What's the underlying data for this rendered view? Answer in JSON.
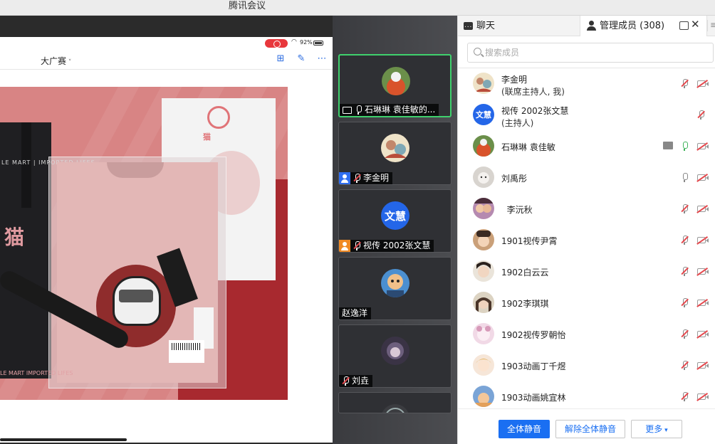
{
  "window": {
    "title": "腾讯会议"
  },
  "shared_screen": {
    "status_battery": "92%",
    "doc_title": "大广赛",
    "artwork_texts": {
      "bag_text": "LE MART",
      "bag_text_tail": "IMPORTED LIFES",
      "bag_bottom_text": "LE MART   IMPORTED LIFES",
      "card_brand": "猫"
    }
  },
  "video_tiles": [
    {
      "label": "石琳琳 袁佳敏的...",
      "active": true,
      "avatar_type": "image"
    },
    {
      "label": "李金明",
      "active": false,
      "avatar_type": "image"
    },
    {
      "label": "视传 2002张文慧",
      "active": false,
      "avatar_type": "text",
      "avatar_text": "文慧"
    },
    {
      "label": "赵逸洋",
      "active": false,
      "avatar_type": "image"
    },
    {
      "label": "刘垚",
      "active": false,
      "avatar_type": "image"
    }
  ],
  "panel": {
    "tab_chat": "聊天",
    "tab_members": "管理成员 (308)",
    "search_placeholder": "搜索成员",
    "members": [
      {
        "name": "李金明",
        "role": "(联席主持人, 我)",
        "mic": "off",
        "avatar": "sketch"
      },
      {
        "name": "视传 2002张文慧",
        "role": "(主持人)",
        "mic": "off",
        "avatar_text": "文慧"
      },
      {
        "name": "石琳琳 袁佳敏",
        "role": "",
        "mic": "on",
        "sharing": true,
        "avatar": "photo1"
      },
      {
        "name": "刘禹彤",
        "role": "",
        "mic": "idle",
        "avatar": "photo2"
      },
      {
        "name": "  李沅秋",
        "role": "",
        "mic": "off",
        "avatar": "photo3"
      },
      {
        "name": "1901视传尹霄",
        "role": "",
        "mic": "off",
        "avatar": "photo4"
      },
      {
        "name": "1902白云云",
        "role": "",
        "mic": "off",
        "avatar": "photo5"
      },
      {
        "name": "1902李琪琪",
        "role": "",
        "mic": "off",
        "avatar": "photo6"
      },
      {
        "name": "1902视传罗朝怡",
        "role": "",
        "mic": "off",
        "avatar": "photo7"
      },
      {
        "name": "1903动画丁千煜",
        "role": "",
        "mic": "off",
        "avatar": "photo8"
      },
      {
        "name": "1903动画姚宜林",
        "role": "",
        "mic": "off",
        "avatar": "photo9"
      }
    ],
    "buttons": {
      "mute_all": "全体静音",
      "unmute_all": "解除全体静音",
      "more": "更多"
    }
  },
  "colors": {
    "accent": "#1a6ff2",
    "active_speaker": "#3fd16d",
    "muted": "#e5484d"
  }
}
